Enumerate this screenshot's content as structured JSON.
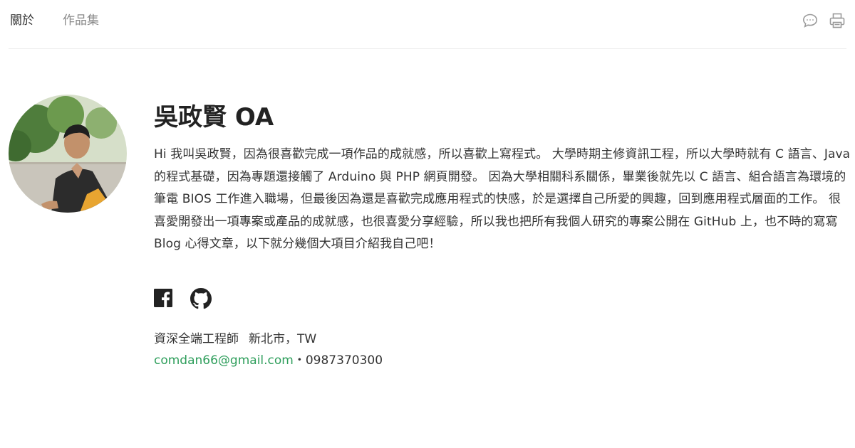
{
  "nav": {
    "tabs": [
      {
        "label": "關於",
        "active": true
      },
      {
        "label": "作品集",
        "active": false
      }
    ],
    "icons": [
      "comment-icon",
      "print-icon"
    ]
  },
  "profile": {
    "name": "吳政賢 OA",
    "bio": "Hi 我叫吳政賢，因為很喜歡完成一項作品的成就感，所以喜歡上寫程式。 大學時期主修資訊工程，所以大學時就有 C 語言、Java 的程式基礎，因為專題還接觸了 Arduino 與 PHP 網頁開發。 因為大學相關科系關係，畢業後就先以 C 語言、組合語言為環境的筆電 BIOS 工作進入職場，但最後因為還是喜歡完成應用程式的快感，於是選擇自己所愛的興趣，回到應用程式層面的工作。 很喜愛開發出一項專案或產品的成就感，也很喜愛分享經驗，所以我也把所有我個人研究的專案公開在 GitHub 上，也不時的寫寫 Blog 心得文章，以下就分幾個大項目介紹我自己吧！",
    "socials": [
      "facebook-icon",
      "github-icon"
    ],
    "job_title": "資深全端工程師",
    "location": "新北市，TW",
    "email": "comdan66@gmail.com",
    "contact_separator": "・",
    "phone": "0987370300"
  },
  "colors": {
    "link": "#2e9e5b",
    "text": "#333333",
    "muted": "#888888",
    "divider": "#ececec"
  }
}
